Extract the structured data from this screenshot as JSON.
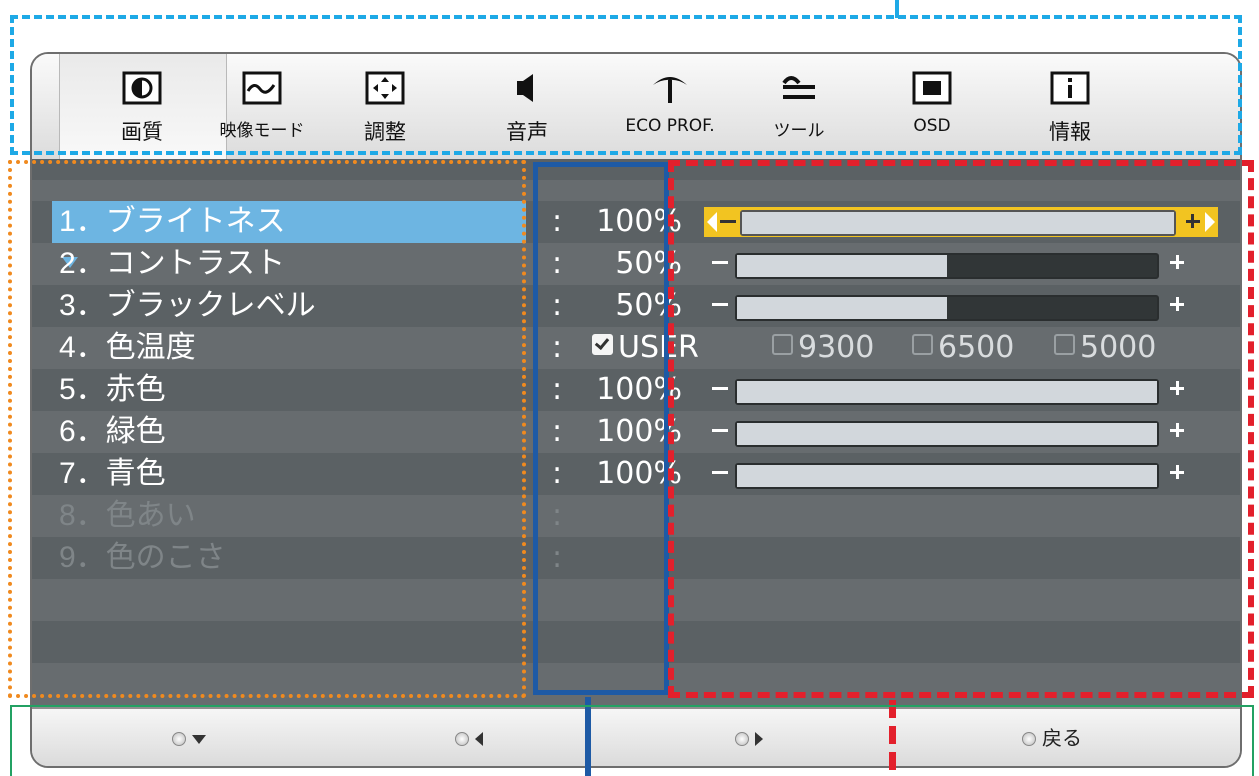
{
  "tabs": [
    {
      "label": "画質",
      "icon": "contrast-icon",
      "active": true
    },
    {
      "label": "映像モード",
      "icon": "waveform-icon",
      "active": false
    },
    {
      "label": "調整",
      "icon": "arrows-adjust-icon",
      "active": false
    },
    {
      "label": "音声",
      "icon": "speaker-icon",
      "active": false
    },
    {
      "label": "ECO PROF.",
      "icon": "eco-tree-icon",
      "active": false
    },
    {
      "label": "ツール",
      "icon": "wrench-icon",
      "active": false
    },
    {
      "label": "OSD",
      "icon": "osd-screen-icon",
      "active": false
    },
    {
      "label": "情報",
      "icon": "info-icon",
      "active": false
    }
  ],
  "menu": {
    "items": [
      {
        "label": "1．ブライトネス",
        "colon": ":",
        "value": "100%",
        "selected": true,
        "level": 1.0
      },
      {
        "label": "2．コントラスト",
        "colon": ":",
        "value": "50%",
        "level": 0.5
      },
      {
        "label": "3．ブラックレベル",
        "colon": ":",
        "value": "50%",
        "level": 0.5
      },
      {
        "label": "4．色温度",
        "colon": ":",
        "value": ""
      },
      {
        "label": "5．赤色",
        "colon": ":",
        "value": "100%",
        "level": 1.0
      },
      {
        "label": "6．緑色",
        "colon": ":",
        "value": "100%",
        "level": 1.0
      },
      {
        "label": "7．青色",
        "colon": ":",
        "value": "100%",
        "level": 1.0
      },
      {
        "label": "8．色あい",
        "colon": ":",
        "value": "",
        "disabled": true
      },
      {
        "label": "9．色のこさ",
        "colon": ":",
        "value": "",
        "disabled": true
      }
    ],
    "color_temp_options": [
      {
        "label": "USER",
        "checked": true
      },
      {
        "label": "9300",
        "checked": false
      },
      {
        "label": "6500",
        "checked": false
      },
      {
        "label": "5000",
        "checked": false
      }
    ]
  },
  "bottom": {
    "down_label": "",
    "left_label": "",
    "right_label": "",
    "back_label": "戻る"
  },
  "colors": {
    "selection": "#6db5e2",
    "highlight_slider": "#f2c421",
    "panel_bg": "#5b6164",
    "callout_blue": "#1ea9e6",
    "callout_orange": "#f08a1f",
    "callout_navy": "#1e5aa5",
    "callout_red": "#e3202c",
    "callout_green": "#23a163"
  }
}
